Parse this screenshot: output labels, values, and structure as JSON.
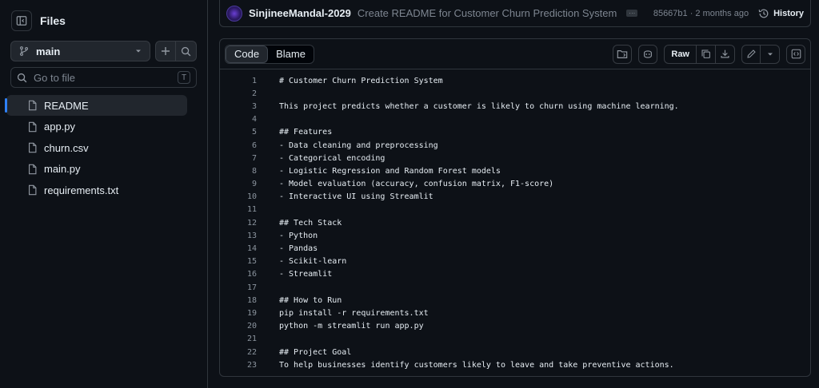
{
  "sidebar": {
    "title": "Files",
    "branch": "main",
    "goto_placeholder": "Go to file",
    "goto_shortcut": "T",
    "files": [
      {
        "name": "README",
        "active": true
      },
      {
        "name": "app.py",
        "active": false
      },
      {
        "name": "churn.csv",
        "active": false
      },
      {
        "name": "main.py",
        "active": false
      },
      {
        "name": "requirements.txt",
        "active": false
      }
    ]
  },
  "commit": {
    "author": "SinjineeMandal-2029",
    "message": "Create README for Customer Churn Prediction System",
    "dots": "···",
    "meta": "85667b1 · 2 months ago",
    "history_label": "History"
  },
  "viewer": {
    "tab_code": "Code",
    "tab_blame": "Blame",
    "raw_label": "Raw"
  },
  "code_lines": [
    {
      "n": "1",
      "text": "# Customer Churn Prediction System"
    },
    {
      "n": "2",
      "text": ""
    },
    {
      "n": "3",
      "text": "This project predicts whether a customer is likely to churn using machine learning."
    },
    {
      "n": "4",
      "text": ""
    },
    {
      "n": "5",
      "text": "## Features"
    },
    {
      "n": "6",
      "text": "- Data cleaning and preprocessing"
    },
    {
      "n": "7",
      "text": "- Categorical encoding"
    },
    {
      "n": "8",
      "text": "- Logistic Regression and Random Forest models"
    },
    {
      "n": "9",
      "text": "- Model evaluation (accuracy, confusion matrix, F1-score)"
    },
    {
      "n": "10",
      "text": "- Interactive UI using Streamlit"
    },
    {
      "n": "11",
      "text": ""
    },
    {
      "n": "12",
      "text": "## Tech Stack"
    },
    {
      "n": "13",
      "text": "- Python"
    },
    {
      "n": "14",
      "text": "- Pandas"
    },
    {
      "n": "15",
      "text": "- Scikit-learn"
    },
    {
      "n": "16",
      "text": "- Streamlit"
    },
    {
      "n": "17",
      "text": ""
    },
    {
      "n": "18",
      "text": "## How to Run"
    },
    {
      "n": "19",
      "text": "pip install -r requirements.txt"
    },
    {
      "n": "20",
      "text": "python -m streamlit run app.py"
    },
    {
      "n": "21",
      "text": ""
    },
    {
      "n": "22",
      "text": "## Project Goal"
    },
    {
      "n": "23",
      "text": "To help businesses identify customers likely to leave and take preventive actions."
    }
  ]
}
